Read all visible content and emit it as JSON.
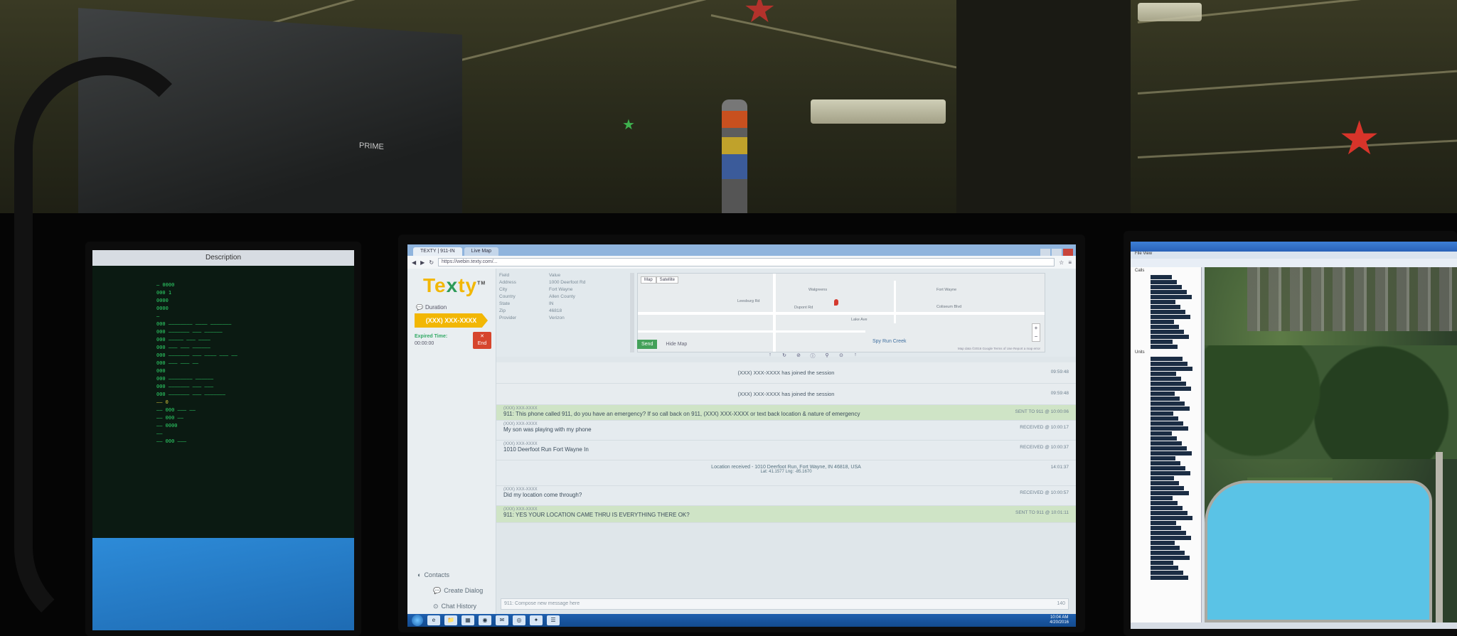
{
  "room": {
    "rack_label": "PRIME"
  },
  "left_monitor": {
    "title": "Description",
    "lines": [
      "— 0000",
      "000 1",
      "0000",
      "0000",
      "—",
      "000 ———————— ———— ———————",
      "000 ——————— ——— ——————",
      "000 ————— ——— ————",
      "000 ——— ——— ——————",
      "000 ——————— ——— ———— ——— ——",
      "000 ——— ——— ——",
      "000",
      "000 ———————— ——————",
      "000 ——————— ——— ———",
      "",
      "000 ——————— ——— ———————",
      "—— 0",
      "—— 000 ——— ——",
      "—— 000 ——",
      "—— 0000",
      "——",
      "—— 000 ———"
    ]
  },
  "browser": {
    "tabs": [
      "TEXTY | 911-IN",
      "Live Map"
    ],
    "url": "https://webin.texty.com/..."
  },
  "app": {
    "logo_prefix": "Te",
    "logo_x": "x",
    "logo_suffix": "ty",
    "logo_mark": "TM",
    "section_duration": "Duration",
    "phone_ribbon": "(XXX) XXX-XXXX",
    "expired_label": "Expired Time:",
    "expired_value": "00:00:00",
    "end_button": "End",
    "info": [
      {
        "k": "Field",
        "v": "Value"
      },
      {
        "k": "Address",
        "v": "1000 Deerfoot Rd"
      },
      {
        "k": "City",
        "v": "Fort Wayne"
      },
      {
        "k": "Country",
        "v": "Allen County"
      },
      {
        "k": "State",
        "v": "IN"
      },
      {
        "k": "Zip",
        "v": "46818"
      },
      {
        "k": "Provider",
        "v": "Verizon"
      }
    ],
    "map_tabs": [
      "Map",
      "Satellite"
    ],
    "map_labels": [
      "Leesburg Rd",
      "Walgreens",
      "Fort Wayne",
      "Dupont Rd",
      "Spy Run Creek",
      "Lake Ave",
      "Coliseum Blvd"
    ],
    "map_river": "Spy Run Creek",
    "map_footer": "Map data ©2016 Google  Terms of Use  Report a map error",
    "send_button": "Send",
    "hide_map_button": "Hide Map",
    "sidebar_contacts": "Contacts",
    "sidebar_create_dialog": "Create Dialog",
    "sidebar_chat_history": "Chat History"
  },
  "chat": {
    "system": [
      {
        "text": "(XXX) XXX-XXXX has joined the session",
        "time": "09:59:48"
      },
      {
        "text": "(XXX) XXX-XXXX has joined the session",
        "time": "09:59:48"
      }
    ],
    "msg1": {
      "who": "(XXX) XXX-XXXX",
      "text": "911: This phone called 911, do you have an emergency? If so call back on 911, (XXX) XXX-XXXX or text back location & nature of emergency",
      "time": "SENT TO 911 @ 10:00:06"
    },
    "msg2": {
      "who": "(XXX) XXX-XXXX",
      "text": "My son was playing with my phone",
      "time": "RECEIVED @ 10:00:17"
    },
    "msg3": {
      "who": "(XXX) XXX-XXXX",
      "text": "1010 Deerfoot Run Fort Wayne In",
      "time": "RECEIVED @ 10:00:37"
    },
    "location": {
      "text": "Location received - 1010 Deerfoot Run, Fort Wayne, IN 46818, USA",
      "sub": "Lat: 41.1577 Lng: -85.1670",
      "time": "14:01:37"
    },
    "msg4": {
      "who": "(XXX) XXX-XXXX",
      "text": "Did my location come through?",
      "time": "RECEIVED @ 10:00:57"
    },
    "msg5": {
      "who": "(XXX) XXX-XXXX",
      "text": "911: YES YOUR LOCATION CAME THRU IS EVERYTHING THERE OK?",
      "time": "SENT TO 911 @ 10:01:11"
    },
    "input_placeholder": "911: Compose new message here",
    "input_count": "140"
  },
  "taskbar": {
    "time": "10:04 AM",
    "date": "4/20/2016",
    "apps": [
      "e",
      "📁",
      "▦",
      "◉",
      "✉",
      "◎",
      "✦",
      "☰"
    ]
  },
  "right_monitor": {
    "menu": "File   View",
    "list_header": "Calls",
    "list_header2": "Units"
  }
}
